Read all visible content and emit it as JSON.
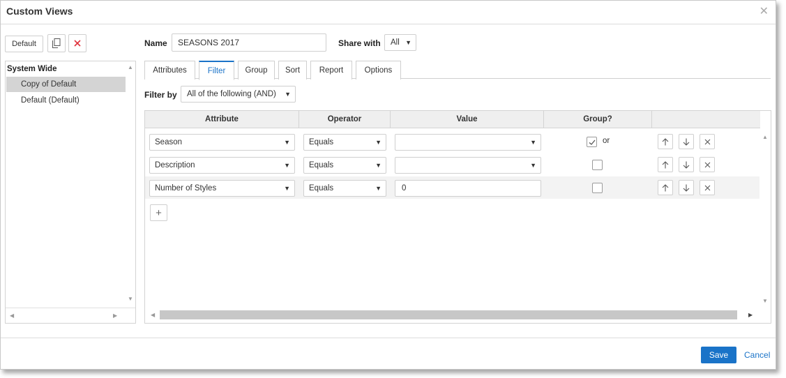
{
  "window": {
    "title": "Custom Views"
  },
  "toolbar": {
    "default_label": "Default"
  },
  "views_list": {
    "header": "System Wide",
    "items": [
      {
        "label": "Copy of Default",
        "selected": true
      },
      {
        "label": "Default (Default)",
        "selected": false
      }
    ]
  },
  "form": {
    "name_label": "Name",
    "name_value": "SEASONS 2017",
    "share_label": "Share with",
    "share_value": "All"
  },
  "tabs": [
    {
      "label": "Attributes",
      "active": false
    },
    {
      "label": "Filter",
      "active": true
    },
    {
      "label": "Group",
      "active": false
    },
    {
      "label": "Sort",
      "active": false
    },
    {
      "label": "Report",
      "active": false
    },
    {
      "label": "Options",
      "active": false
    }
  ],
  "filter": {
    "filter_by_label": "Filter by",
    "filter_by_value": "All of the following (AND)"
  },
  "grid": {
    "columns": [
      "Attribute",
      "Operator",
      "Value",
      "Group?",
      ""
    ],
    "rows": [
      {
        "attribute": "Season",
        "operator": "Equals",
        "value": "",
        "value_type": "select",
        "group": true,
        "group_text": "or"
      },
      {
        "attribute": "Description",
        "operator": "Equals",
        "value": "",
        "value_type": "select",
        "group": false,
        "group_text": ""
      },
      {
        "attribute": "Number of Styles",
        "operator": "Equals",
        "value": "0",
        "value_type": "input",
        "group": false,
        "group_text": ""
      }
    ]
  },
  "footer": {
    "save_label": "Save",
    "cancel_label": "Cancel"
  },
  "colors": {
    "accent": "#1a73c8",
    "selected_row": "#d4d4d4",
    "delete_icon": "#e0303a"
  },
  "icons": [
    "close-icon",
    "copy-icon",
    "delete-icon",
    "arrow-up-icon",
    "arrow-down-icon",
    "remove-icon",
    "plus-icon",
    "caret-down-icon"
  ]
}
